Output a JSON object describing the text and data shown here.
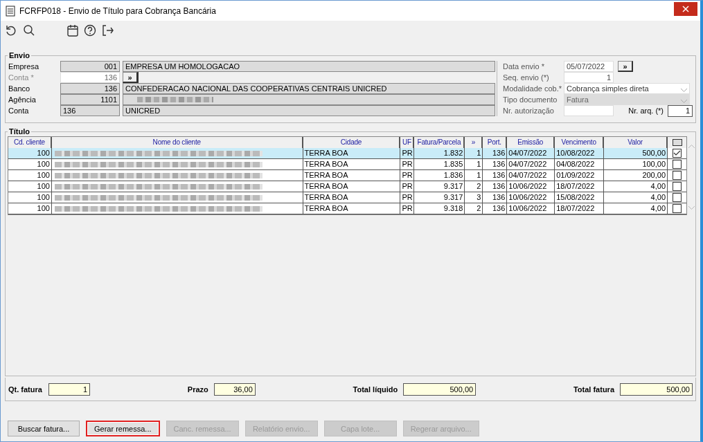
{
  "window": {
    "title": "FCRFP018 - Envio de Título para Cobrança Bancária"
  },
  "envio": {
    "title": "Envio",
    "left_fields": [
      {
        "kind": "lookup",
        "label": "Empresa",
        "muted": false,
        "value": "001",
        "description": "EMPRESA UM HOMOLOGACAO"
      },
      {
        "kind": "search",
        "label": "Conta *",
        "muted": true,
        "value": "136",
        "button": "»"
      },
      {
        "kind": "lookup",
        "label": "Banco",
        "muted": false,
        "value": "136",
        "description": "CONFEDERACAO NACIONAL DAS COOPERATIVAS CENTRAIS UNICRED"
      },
      {
        "kind": "redacted",
        "label": "Agência",
        "muted": false,
        "value": "1101"
      },
      {
        "kind": "text",
        "label": "Conta",
        "muted": false,
        "value": "136",
        "description": "UNICRED"
      }
    ],
    "right_fields": [
      {
        "kind": "date",
        "label": "Data envio *",
        "value": "05/07/2022",
        "button": "»"
      },
      {
        "kind": "number",
        "label": "Seq. envio (*)",
        "value": "1"
      },
      {
        "kind": "select",
        "label": "Modalidade cob.*",
        "value": "Cobrança simples direta",
        "disabled": false
      },
      {
        "kind": "select",
        "label": "Tipo documento",
        "value": "Fatura",
        "disabled": true
      },
      {
        "kind": "pair",
        "label": "Nr. autorização",
        "extra_label": "Nr. arq. (*)",
        "extra_value": "1"
      }
    ]
  },
  "titulo": {
    "title": "Título",
    "columns": [
      "Cd. cliente",
      "Nome do cliente",
      "Cidade",
      "UF",
      "Fatura/Parcela",
      "»",
      "Port.",
      "Emissão",
      "Vencimento",
      "Valor"
    ],
    "rows": [
      {
        "selected": true,
        "checked": true,
        "cells": [
          "100",
          "",
          "TERRA BOA",
          "PR",
          "1.832",
          "1",
          "136",
          "04/07/2022",
          "10/08/2022",
          "500,00"
        ]
      },
      {
        "selected": false,
        "checked": false,
        "cells": [
          "100",
          "",
          "TERRA BOA",
          "PR",
          "1.835",
          "1",
          "136",
          "04/07/2022",
          "04/08/2022",
          "100,00"
        ]
      },
      {
        "selected": false,
        "checked": false,
        "cells": [
          "100",
          "",
          "TERRA BOA",
          "PR",
          "1.836",
          "1",
          "136",
          "04/07/2022",
          "01/09/2022",
          "200,00"
        ]
      },
      {
        "selected": false,
        "checked": false,
        "cells": [
          "100",
          "",
          "TERRA BOA",
          "PR",
          "9.317",
          "2",
          "136",
          "10/06/2022",
          "18/07/2022",
          "4,00"
        ]
      },
      {
        "selected": false,
        "checked": false,
        "cells": [
          "100",
          "",
          "TERRA BOA",
          "PR",
          "9.317",
          "3",
          "136",
          "10/06/2022",
          "15/08/2022",
          "4,00"
        ]
      },
      {
        "selected": false,
        "checked": false,
        "cells": [
          "100",
          "",
          "TERRA BOA",
          "PR",
          "9.318",
          "2",
          "136",
          "10/06/2022",
          "18/07/2022",
          "4,00"
        ]
      }
    ]
  },
  "totals": [
    {
      "label": "Qt. fatura",
      "value": "1"
    },
    {
      "label": "Prazo",
      "value": "36,00"
    },
    {
      "label": "Total líquido",
      "value": "500,00"
    },
    {
      "label": "Total fatura",
      "value": "500,00"
    }
  ],
  "buttons": [
    {
      "label": "Buscar fatura...",
      "disabled": false,
      "highlighted": false
    },
    {
      "label": "Gerar remessa...",
      "disabled": false,
      "highlighted": true
    },
    {
      "label": "Canc. remessa...",
      "disabled": true,
      "highlighted": false
    },
    {
      "label": "Relatório envio...",
      "disabled": true,
      "highlighted": false
    },
    {
      "label": "Capa lote...",
      "disabled": true,
      "highlighted": false
    },
    {
      "label": "Regerar arquivo...",
      "disabled": true,
      "highlighted": false
    }
  ]
}
